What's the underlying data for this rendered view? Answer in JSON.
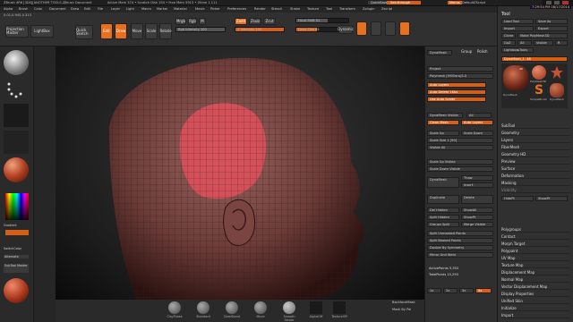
{
  "titlebar": {
    "app": "ZBrush 4R6 [3DS][ANOTHER TOOLS...]",
    "doc": "ZBrush Document",
    "mem": "Active Mem 374 • Scratch Disk 154 • Free Mem 5913 • Ztime 1.111",
    "quicksave": "QuickSave",
    "seethrough": "See-through",
    "menus_btn": "Menus",
    "default_script": "DefaultZScript"
  },
  "coords": "0.01,0.945,0.313",
  "clock": "7:29:54 PM 08/17/2014",
  "menubar": [
    "Alpha",
    "Brush",
    "Color",
    "Document",
    "Draw",
    "Edit",
    "File",
    "Layer",
    "Light",
    "Macro",
    "Marker",
    "Material",
    "Movie",
    "Picker",
    "Preferences",
    "Render",
    "Stencil",
    "Stroke",
    "Texture",
    "Tool",
    "Transform",
    "Zplugin",
    "Zscript"
  ],
  "toolbar": {
    "projection_master": "Projection Master",
    "lightbox": "LightBox",
    "quick_sketch": "Quick Sketch",
    "edit": "Edit",
    "draw": "Draw",
    "move": "Move",
    "scale": "Scale",
    "rotate": "Rotate",
    "mrgb": "Mrgb",
    "rgb": "Rgb",
    "m": "M",
    "rgb_intensity": "Rgb Intensity 100",
    "zadd": "Zadd",
    "zsub": "Zsub",
    "zcut": "Zcut",
    "z_intensity": "Z Intensity 100",
    "focal_shift": "Focal Shift 51",
    "draw_size": "Draw Size 64",
    "dynamic": "Dynamic"
  },
  "left": {
    "gradient": "Gradient",
    "switch_color": "SwitchColor",
    "alternate": "Alternate",
    "subtool_master": "SubTool Master"
  },
  "palette": {
    "dynamesh": "DynaMesh",
    "group": "Group",
    "polish": "Polish",
    "project": "Project",
    "polymesh": "Polymesh [HMOsra]3.0",
    "auto_layers": "Auto Layers",
    "auto_delete": "Auto Delete 1Kbs",
    "auto_scale": "Use Auto Scaler",
    "dynamesh_visible": "DynaMesh Visible",
    "all": "All",
    "clean_mesh": "Clean Mesh",
    "auto_layers2": "Auto Layers",
    "scale_up": "Scale Up",
    "scale_down": "Scale Down",
    "scale_size": "Scale Size 1 [90]",
    "visible_all": "Visible All",
    "scale_up_visible": "Scale Up Visible",
    "scale_down_visible": "Scale Down Visible",
    "dynamesh2": "DynaMesh",
    "thaw": "Thaw",
    "insert": "Insert",
    "duplicate": "Duplicate",
    "delete": "Delete",
    "del_hidden": "Del Hidden",
    "show_all": "ShowAll",
    "split_hidden": "Split Hidden",
    "show_pt": "ShowPt",
    "groups_split": "Groups Split",
    "merge_visible": "Merge Visible",
    "split_unmasked": "Split Unmasked Points",
    "split_masked": "Split Masked Points",
    "double_by_symmetry": "Double By Symmetry",
    "mirror_and_weld": "Mirror And Weld",
    "active_points": "ActivePoints 5,552",
    "total_points": "TotalPoints 15,293",
    "buttons_row": [
      "1x",
      "2x",
      "3x",
      "4x"
    ]
  },
  "tool": {
    "title": "Tool",
    "load_tool": "Load Tool",
    "save_as": "Save As",
    "import": "Import",
    "export": "Export",
    "clone": "Clone",
    "make_polymesh": "Make PolyMesh3D",
    "goz": "GoZ",
    "all": "All",
    "visible": "Visible",
    "r": "R",
    "lightbox_tools": "Lightbox▸Tools",
    "current_tool": "DynaMesh_1. 48",
    "thumb_labels": [
      "DynaMesh",
      "PolyMesh3D",
      "SimpleBrush",
      "DynaMesh"
    ],
    "thumb_count": "48",
    "sections": [
      "SubTool",
      "Geometry",
      "Layers",
      "FiberMesh",
      "Geometry HD",
      "Preview",
      "Surface",
      "Deformation",
      "Masking",
      "Visibility"
    ],
    "subtool_row": [
      "HidePt",
      "ShowPt"
    ],
    "sections2": [
      "Polygroups",
      "Contact",
      "Morph Target",
      "Polypaint",
      "UV Map",
      "Texture Map",
      "Displacement Map",
      "Normal Map",
      "Vector Displacement Map",
      "Display Properties",
      "Unified Skin",
      "Initialize",
      "Import"
    ]
  },
  "bottom": {
    "items": [
      "ClayTubes",
      "Standard",
      "DamStand",
      "Move",
      "Smooth Stroke",
      "AlphaOff",
      "TextureOff",
      "BackfaceMask",
      "Mask By Pol"
    ]
  }
}
